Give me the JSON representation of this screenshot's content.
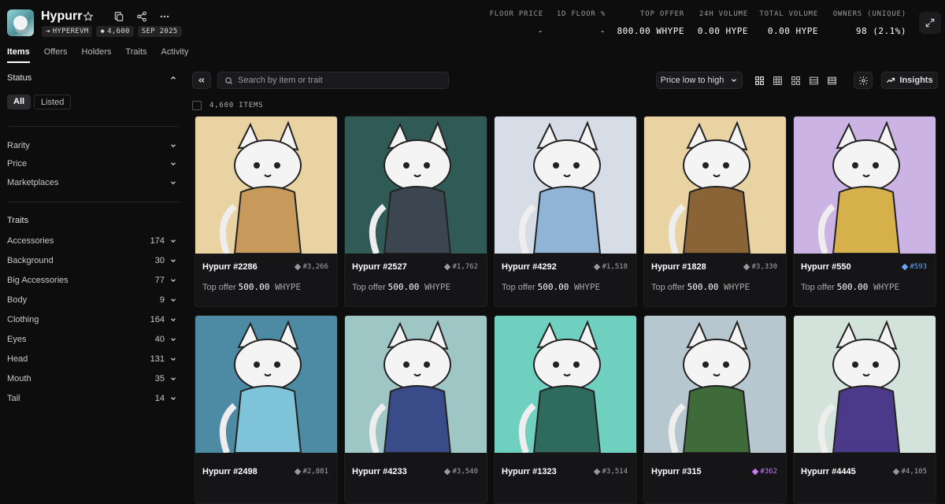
{
  "collection": {
    "name": "Hypurr",
    "chain": "HYPEREVM",
    "supply": "4,600",
    "date": "SEP 2025"
  },
  "stats": [
    {
      "label": "FLOOR PRICE",
      "value": "-"
    },
    {
      "label": "1D FLOOR %",
      "value": "-"
    },
    {
      "label": "TOP OFFER",
      "value": "800.00 WHYPE"
    },
    {
      "label": "24H VOLUME",
      "value": "0.00 HYPE"
    },
    {
      "label": "TOTAL VOLUME",
      "value": "0.00 HYPE"
    },
    {
      "label": "OWNERS (UNIQUE)",
      "value": "98 (2.1%)"
    }
  ],
  "tabs": [
    "Items",
    "Offers",
    "Holders",
    "Traits",
    "Activity"
  ],
  "sidebar": {
    "status_title": "Status",
    "status_options": [
      "All",
      "Listed"
    ],
    "filters": [
      "Rarity",
      "Price",
      "Marketplaces"
    ],
    "traits_title": "Traits",
    "traits": [
      {
        "name": "Accessories",
        "count": "174"
      },
      {
        "name": "Background",
        "count": "30"
      },
      {
        "name": "Big Accessories",
        "count": "77"
      },
      {
        "name": "Body",
        "count": "9"
      },
      {
        "name": "Clothing",
        "count": "164"
      },
      {
        "name": "Eyes",
        "count": "40"
      },
      {
        "name": "Head",
        "count": "131"
      },
      {
        "name": "Mouth",
        "count": "35"
      },
      {
        "name": "Tail",
        "count": "14"
      }
    ]
  },
  "toolbar": {
    "search_placeholder": "Search by item or trait",
    "sort_label": "Price low to high",
    "insights_label": "Insights",
    "items_count": "4,600 ITEMS"
  },
  "items": [
    {
      "name": "Hypurr #2286",
      "rank": "#3,266",
      "offer_label": "Top offer",
      "offer_amount": "500.00",
      "offer_token": "WHYPE",
      "bg": "#ead3a3",
      "accent": "#c79a5b"
    },
    {
      "name": "Hypurr #2527",
      "rank": "#1,762",
      "offer_label": "Top offer",
      "offer_amount": "500.00",
      "offer_token": "WHYPE",
      "bg": "#2f5a55",
      "accent": "#3b4650"
    },
    {
      "name": "Hypurr #4292",
      "rank": "#1,518",
      "offer_label": "Top offer",
      "offer_amount": "500.00",
      "offer_token": "WHYPE",
      "bg": "#d7dde6",
      "accent": "#8fb4d6"
    },
    {
      "name": "Hypurr #1828",
      "rank": "#3,330",
      "offer_label": "Top offer",
      "offer_amount": "500.00",
      "offer_token": "WHYPE",
      "bg": "#ead3a3",
      "accent": "#8a6436"
    },
    {
      "name": "Hypurr #550",
      "rank": "#593",
      "offer_label": "Top offer",
      "offer_amount": "500.00",
      "offer_token": "WHYPE",
      "bg": "#cbb4e3",
      "accent": "#d6b04a",
      "rank_color": "#6aa6ff"
    },
    {
      "name": "Hypurr #2498",
      "rank": "#2,881",
      "bg": "#4d8aa3",
      "accent": "#7ec3d8"
    },
    {
      "name": "Hypurr #4233",
      "rank": "#3,540",
      "bg": "#9ec6c4",
      "accent": "#3a4b8a"
    },
    {
      "name": "Hypurr #1323",
      "rank": "#3,514",
      "bg": "#6fd0c0",
      "accent": "#2f6b5c"
    },
    {
      "name": "Hypurr #315",
      "rank": "#362",
      "bg": "#b7c7cf",
      "accent": "#3f6b3a",
      "rank_color": "#c77dff"
    },
    {
      "name": "Hypurr #4445",
      "rank": "#4,105",
      "bg": "#d3e3dc",
      "accent": "#4b3a8a"
    }
  ]
}
